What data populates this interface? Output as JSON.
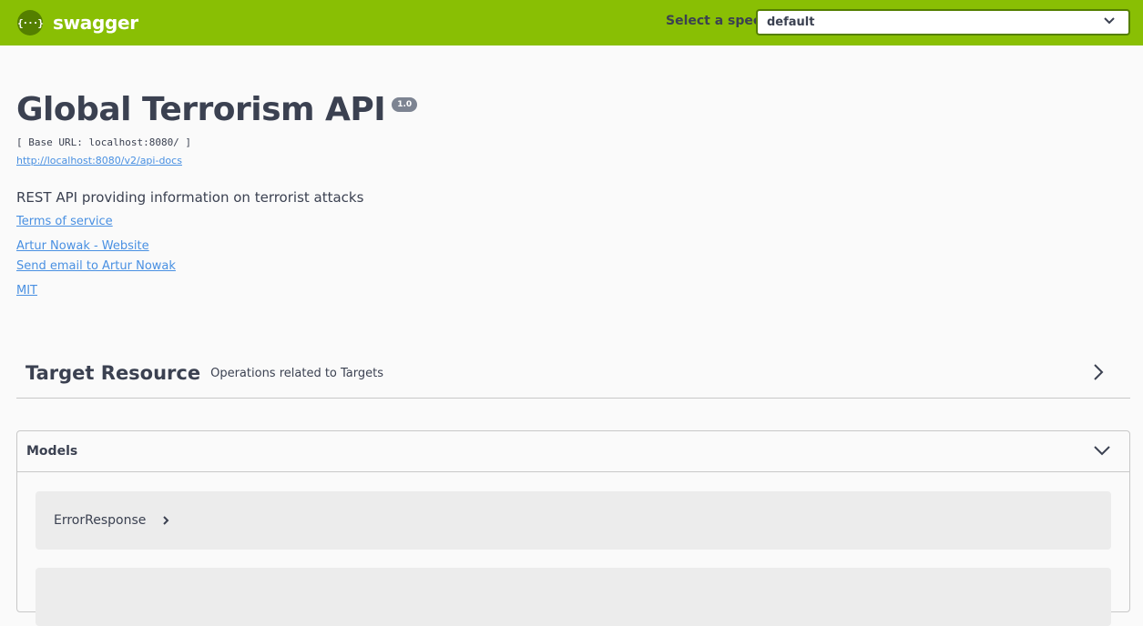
{
  "topbar": {
    "brand": "swagger",
    "logo_glyph": "{···}",
    "select_label": "Select a spec",
    "select_value": "default",
    "color": "#89bf04"
  },
  "info": {
    "title": "Global Terrorism API",
    "version": "1.0",
    "base_url": "[ Base URL: localhost:8080/ ]",
    "docs_url": "http://localhost:8080/v2/api-docs",
    "description": "REST API providing information on terrorist attacks",
    "terms": "Terms of service",
    "contact_website": "Artur Nowak - Website",
    "contact_email": "Send email to Artur Nowak",
    "license": "MIT"
  },
  "resource": {
    "name": "Target Resource",
    "description": "Operations related to Targets",
    "icon": "chevron-right-icon"
  },
  "models": {
    "header": "Models",
    "icon": "chevron-down-icon",
    "items": [
      {
        "name": "ErrorResponse"
      }
    ]
  },
  "colors": {
    "link": "#4990e2",
    "text": "#3b4151",
    "version_badge": "#7d8492"
  }
}
